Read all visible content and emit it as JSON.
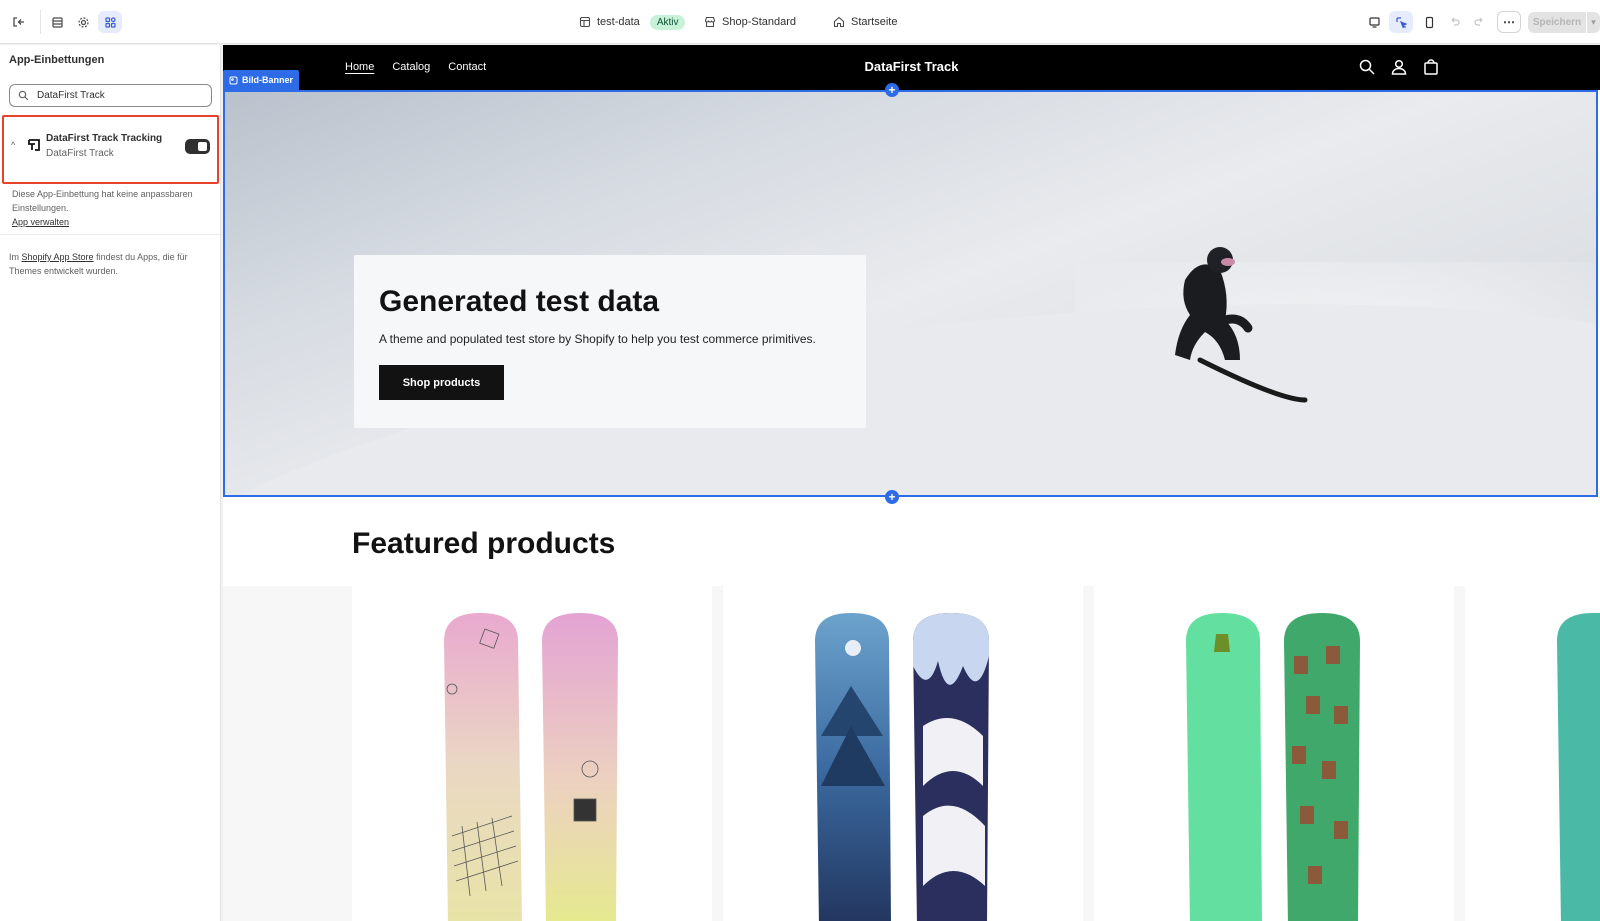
{
  "topbar": {
    "theme_name": "test-data",
    "theme_status": "Aktiv",
    "template": "Shop-Standard",
    "page": "Startseite",
    "save_label": "Speichern",
    "icons": [
      "exit-icon",
      "sections-icon",
      "settings-icon",
      "apps-icon",
      "desktop-icon",
      "inspector-icon",
      "mobile-icon",
      "undo-icon",
      "redo-icon",
      "more-icon"
    ]
  },
  "sidebar": {
    "title": "App-Einbettungen",
    "search_value": "DataFirst Track",
    "embed": {
      "name": "DataFirst Track Tracking",
      "app": "DataFirst Track",
      "enabled": true,
      "note": "Diese App-Einbettung hat keine anpassbaren Einstellungen.",
      "manage_link": "App verwalten"
    },
    "footer_prefix": "Im",
    "footer_link": "Shopify App Store",
    "footer_suffix": "findest du Apps, die für Themes entwickelt wurden."
  },
  "store": {
    "nav": [
      "Home",
      "Catalog",
      "Contact"
    ],
    "title": "DataFirst Track",
    "section_tag": "Bild-Banner",
    "hero": {
      "title": "Generated test data",
      "text": "A theme and populated test store by Shopify to help you test commerce primitives.",
      "button": "Shop products"
    },
    "featured_title": "Featured products"
  },
  "colors": {
    "accent": "#2e6be6",
    "highlight": "#e8412c",
    "badge_bg": "#c8f2d7"
  }
}
